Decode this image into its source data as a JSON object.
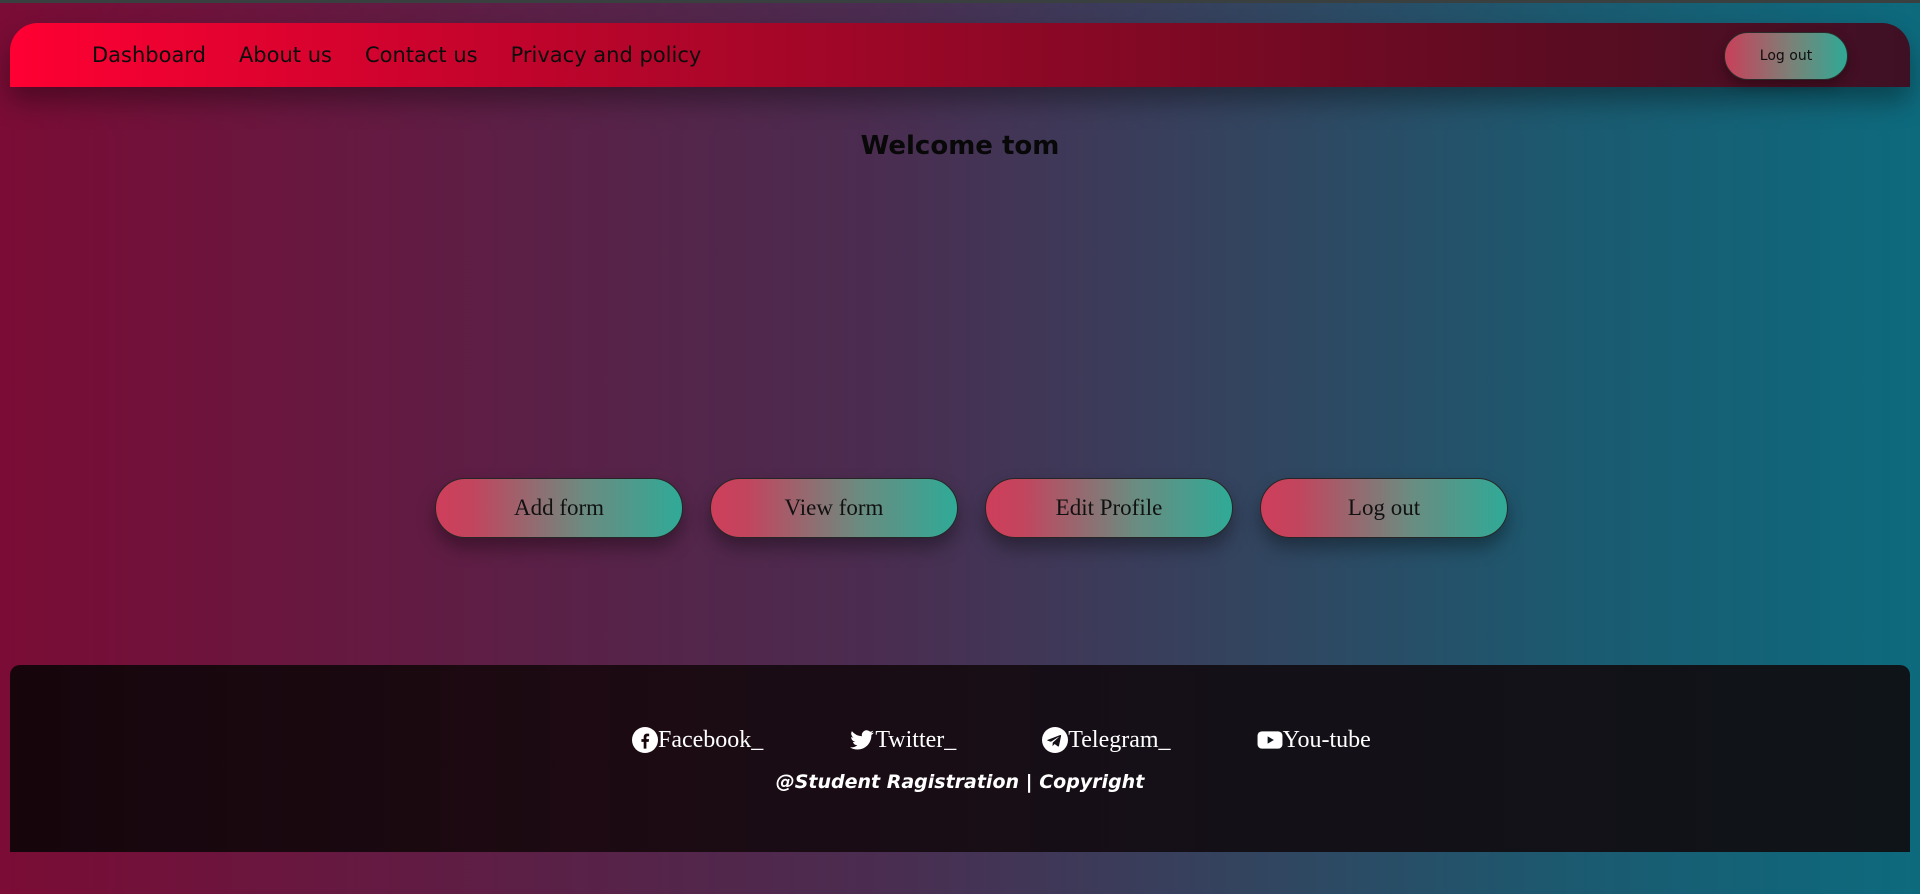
{
  "nav": {
    "links": [
      "Dashboard",
      "About us",
      "Contact us",
      "Privacy and policy"
    ],
    "logout_label": "Log out"
  },
  "welcome": {
    "text": "Welcome tom"
  },
  "actions": {
    "buttons": [
      "Add form",
      "View form",
      "Edit Profile",
      "Log out"
    ]
  },
  "footer": {
    "social": [
      {
        "label": "Facebook_",
        "icon": "facebook-icon"
      },
      {
        "label": "Twitter_",
        "icon": "twitter-icon"
      },
      {
        "label": "Telegram_",
        "icon": "telegram-icon"
      },
      {
        "label": "You-tube",
        "icon": "youtube-icon"
      }
    ],
    "copyright": "@Student Ragistration | Copyright"
  },
  "colors": {
    "nav_gradient_start": "#ff0033",
    "nav_gradient_end": "#3e1024",
    "button_gradient_start": "#cf3e5b",
    "button_gradient_end": "#2faa97",
    "footer_bg": "#16060c"
  }
}
